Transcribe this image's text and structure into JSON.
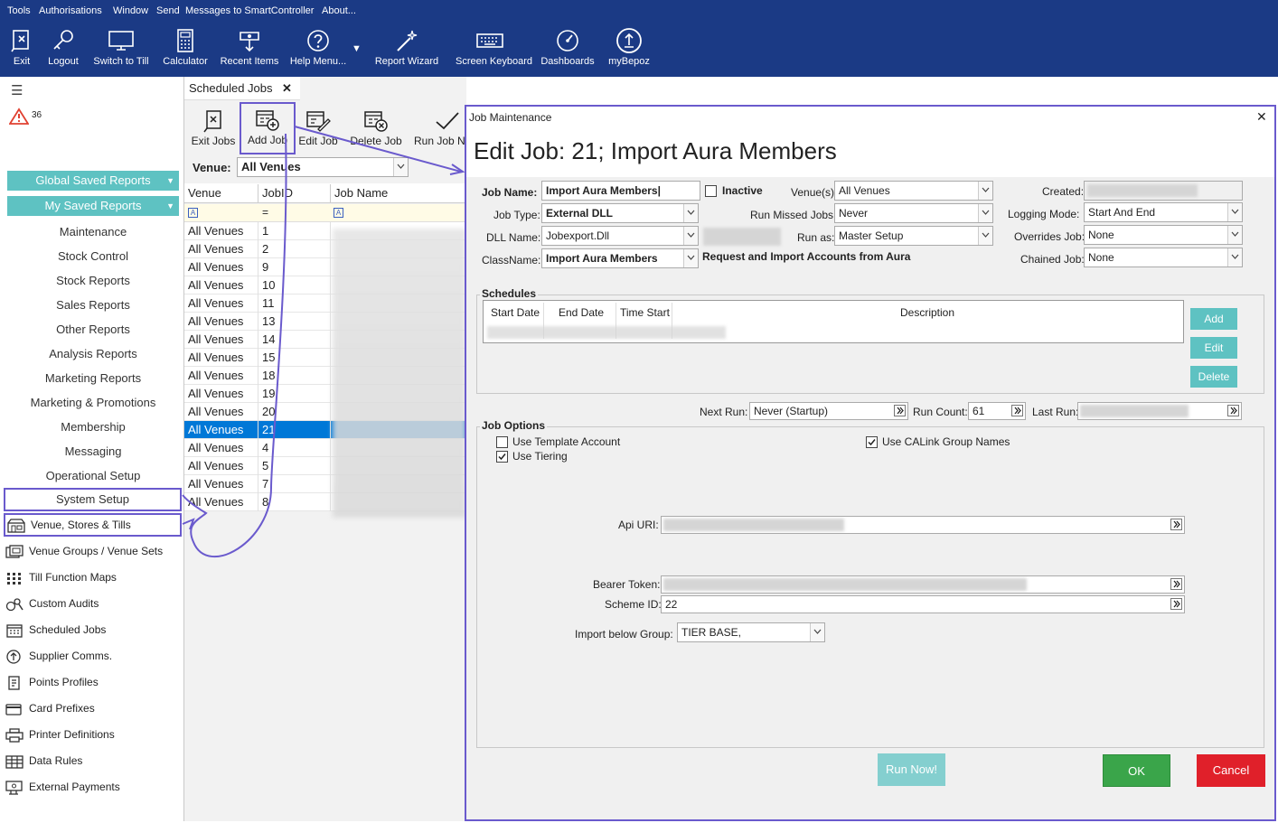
{
  "menu": [
    "Tools",
    "Authorisations",
    "Window",
    "Send",
    "Messages to SmartController",
    "About..."
  ],
  "toolbar": [
    {
      "label": "Exit",
      "icon": "exit-icon"
    },
    {
      "label": "Logout",
      "icon": "key-icon"
    },
    {
      "label": "Switch to Till",
      "icon": "monitor-icon"
    },
    {
      "label": "Calculator",
      "icon": "calculator-icon"
    },
    {
      "label": "Recent Items",
      "icon": "recent-items-icon"
    },
    {
      "label": "Help Menu...",
      "icon": "help-icon"
    },
    {
      "label": "Report Wizard",
      "icon": "wizard-icon"
    },
    {
      "label": "Screen Keyboard",
      "icon": "keyboard-icon"
    },
    {
      "label": "Dashboards",
      "icon": "dashboard-icon"
    },
    {
      "label": "myBepoz",
      "icon": "mybepoz-icon"
    }
  ],
  "sidebar": {
    "alert_count": "36",
    "global_saved": "Global Saved Reports",
    "my_saved": "My Saved Reports",
    "nav": [
      "Maintenance",
      "Stock Control",
      "Stock Reports",
      "Sales Reports",
      "Other Reports",
      "Analysis Reports",
      "Marketing Reports",
      "Marketing & Promotions",
      "Membership",
      "Messaging",
      "Operational Setup",
      "System Setup"
    ],
    "sub": [
      {
        "label": "Venue, Stores & Tills",
        "icon": "venue-icon"
      },
      {
        "label": "Venue Groups / Venue Sets",
        "icon": "venue-groups-icon"
      },
      {
        "label": "Till Function Maps",
        "icon": "grid-icon"
      },
      {
        "label": "Custom Audits",
        "icon": "audit-icon"
      },
      {
        "label": "Scheduled Jobs",
        "icon": "calendar-icon"
      },
      {
        "label": "Supplier Comms.",
        "icon": "supplier-icon"
      },
      {
        "label": "Points Profiles",
        "icon": "points-icon"
      },
      {
        "label": "Card Prefixes",
        "icon": "card-icon"
      },
      {
        "label": "Printer Definitions",
        "icon": "printer-icon"
      },
      {
        "label": "Data Rules",
        "icon": "table-icon"
      },
      {
        "label": "External Payments",
        "icon": "payment-icon"
      }
    ]
  },
  "jobs": {
    "tab_title": "Scheduled Jobs",
    "tools": [
      "Exit Jobs",
      "Add Job",
      "Edit Job",
      "Delete Job",
      "Run Job N"
    ],
    "venue_label": "Venue:",
    "venue_value": "All Venues",
    "columns": [
      "Venue",
      "JobID",
      "Job Name"
    ],
    "filter_eq": "=",
    "rows": [
      {
        "venue": "All Venues",
        "id": "1"
      },
      {
        "venue": "All Venues",
        "id": "2"
      },
      {
        "venue": "All Venues",
        "id": "9"
      },
      {
        "venue": "All Venues",
        "id": "10"
      },
      {
        "venue": "All Venues",
        "id": "11"
      },
      {
        "venue": "All Venues",
        "id": "13"
      },
      {
        "venue": "All Venues",
        "id": "14"
      },
      {
        "venue": "All Venues",
        "id": "15"
      },
      {
        "venue": "All Venues",
        "id": "18"
      },
      {
        "venue": "All Venues",
        "id": "19"
      },
      {
        "venue": "All Venues",
        "id": "20"
      },
      {
        "venue": "All Venues",
        "id": "21"
      },
      {
        "venue": "All Venues",
        "id": "4"
      },
      {
        "venue": "All Venues",
        "id": "5"
      },
      {
        "venue": "All Venues",
        "id": "7"
      },
      {
        "venue": "All Venues",
        "id": "8"
      }
    ],
    "selected_id": "21"
  },
  "dialog": {
    "window_title": "Job Maintenance",
    "heading": "Edit Job: 21; Import Aura Members",
    "job_name_label": "Job Name:",
    "job_name": "Import Aura Members",
    "inactive_label": "Inactive",
    "venues_label": "Venue(s):",
    "venues": "All Venues",
    "created_label": "Created:",
    "job_type_label": "Job Type:",
    "job_type": "External DLL",
    "run_missed_label": "Run Missed Jobs:",
    "run_missed": "Never",
    "logging_label": "Logging Mode:",
    "logging": "Start And End",
    "dll_label": "DLL Name:",
    "dll": "Jobexport.Dll",
    "run_as_label": "Run as:",
    "run_as": "Master Setup",
    "overrides_label": "Overrides Job:",
    "overrides": "None",
    "classname_label": "ClassName:",
    "classname": "Import Aura Members",
    "class_desc": "Request and Import Accounts from Aura",
    "chained_label": "Chained Job:",
    "chained": "None",
    "schedules_title": "Schedules",
    "sched_cols": [
      "Start Date",
      "End Date",
      "Time Start",
      "Description"
    ],
    "sched_buttons": [
      "Add",
      "Edit",
      "Delete"
    ],
    "next_run_label": "Next Run:",
    "next_run": "Never (Startup)",
    "run_count_label": "Run Count:",
    "run_count": "61",
    "last_run_label": "Last Run:",
    "options_title": "Job Options",
    "use_template": "Use Template Account",
    "use_tiering": "Use Tiering",
    "use_calink": "Use CALink Group Names",
    "api_uri_label": "Api URI:",
    "bearer_label": "Bearer Token:",
    "scheme_label": "Scheme ID:",
    "scheme_id": "22",
    "import_group_label": "Import below Group:",
    "import_group": "TIER BASE,",
    "run_now": "Run Now!",
    "ok": "OK",
    "cancel": "Cancel"
  },
  "colors": {
    "topbar": "#1b3a85",
    "accent": "#5ec2c2",
    "highlight": "#6a5acd",
    "ok": "#3aa54a",
    "cancel": "#e0202a",
    "selected": "#0078d7"
  }
}
